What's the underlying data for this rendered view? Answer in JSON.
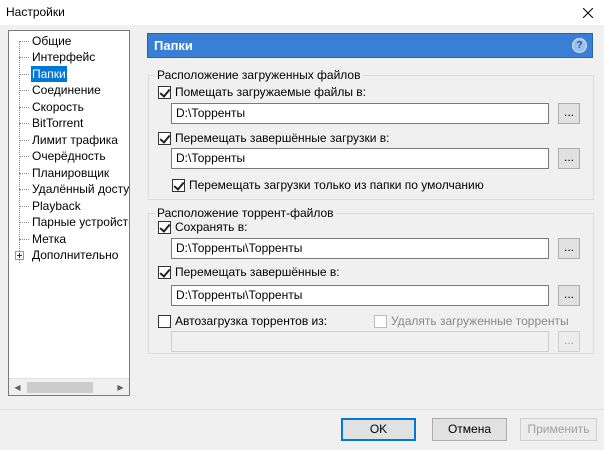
{
  "window": {
    "title": "Настройки",
    "close_icon": "close-icon"
  },
  "sidebar": {
    "items": [
      {
        "label": "Общие"
      },
      {
        "label": "Интерфейс"
      },
      {
        "label": "Папки",
        "selected": true
      },
      {
        "label": "Соединение"
      },
      {
        "label": "Скорость"
      },
      {
        "label": "BitTorrent"
      },
      {
        "label": "Лимит трафика"
      },
      {
        "label": "Очерёдность"
      },
      {
        "label": "Планировщик"
      },
      {
        "label": "Удалённый доступ"
      },
      {
        "label": "Playback"
      },
      {
        "label": "Парные устройства"
      },
      {
        "label": "Метка"
      },
      {
        "label": "Дополнительно",
        "expandable": true
      }
    ]
  },
  "panel": {
    "title": "Папки",
    "help": "?",
    "downloads_group": {
      "title": "Расположение загруженных файлов",
      "put_downloads_label": "Помещать загружаемые файлы в:",
      "put_downloads_checked": true,
      "put_downloads_path": "D:\\Торренты",
      "move_completed_label": "Перемещать завершённые загрузки в:",
      "move_completed_checked": true,
      "move_completed_path": "D:\\Торренты",
      "move_only_default_label": "Перемещать загрузки только из папки по умолчанию",
      "move_only_default_checked": true
    },
    "torrents_group": {
      "title": "Расположение торрент-файлов",
      "save_label": "Сохранять в:",
      "save_checked": true,
      "save_path": "D:\\Торренты\\Торренты",
      "move_completed_label": "Перемещать завершённые в:",
      "move_completed_checked": true,
      "move_completed_path": "D:\\Торренты\\Торренты",
      "autoload_label": "Автозагрузка торрентов из:",
      "autoload_checked": false,
      "delete_loaded_label": "Удалять загруженные торренты",
      "delete_loaded_checked": false,
      "autoload_path": ""
    },
    "browse_label": "..."
  },
  "footer": {
    "ok": "OK",
    "cancel": "Отмена",
    "apply": "Применить"
  }
}
